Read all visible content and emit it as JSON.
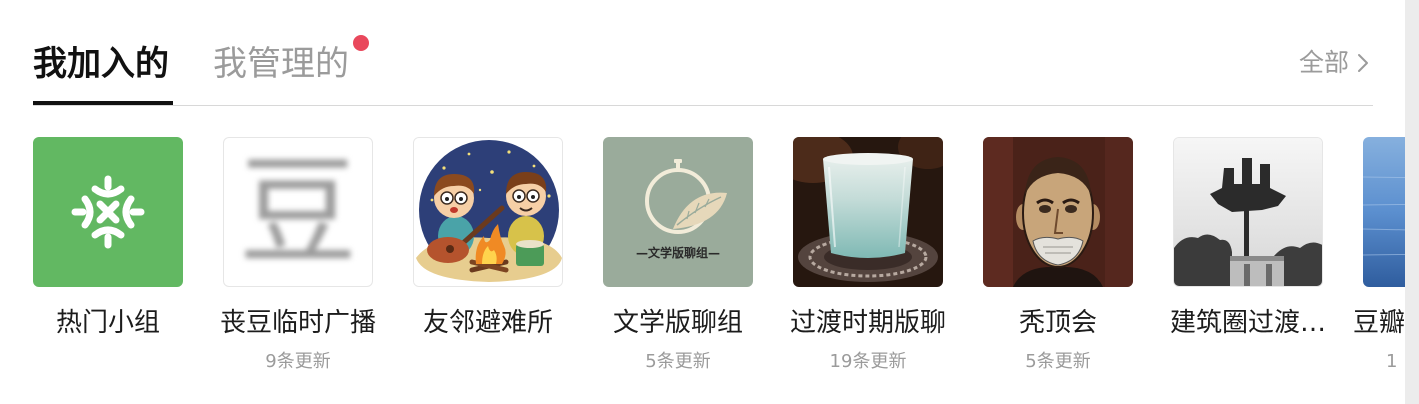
{
  "tabs": {
    "joined": {
      "label": "我加入的",
      "active": true
    },
    "managed": {
      "label": "我管理的",
      "active": false,
      "notification_dot": true
    }
  },
  "all_link": {
    "label": "全部",
    "icon": "chevron-right-icon"
  },
  "colors": {
    "text_primary": "#111111",
    "text_secondary": "#9b9b9b",
    "notification_dot": "#e9485c",
    "hot_groups_green": "#62b862"
  },
  "groups": [
    {
      "name": "热门小组"
    },
    {
      "name": "丧豆临时广播",
      "updates": "9条更新",
      "thumb_text": "豆"
    },
    {
      "name": "友邻避难所"
    },
    {
      "name": "文学版聊组",
      "updates": "5条更新",
      "thumb_text": "—文学版聊组—"
    },
    {
      "name": "过渡时期版聊",
      "updates": "19条更新"
    },
    {
      "name": "秃顶会",
      "updates": "5条更新"
    },
    {
      "name": "建筑圈过渡…"
    },
    {
      "name": "豆瓣",
      "updates": "1"
    }
  ]
}
